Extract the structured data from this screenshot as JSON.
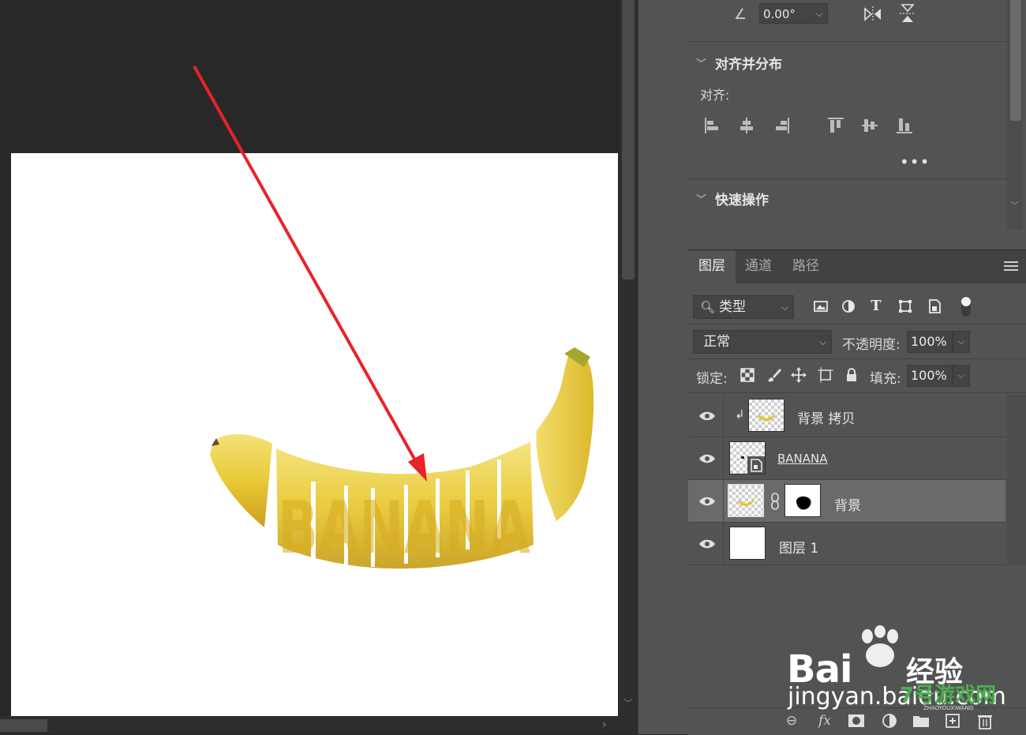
{
  "properties": {
    "angle_value": "0.00°",
    "align_section_title": "对齐并分布",
    "align_label": "对齐:",
    "more_dots": "•••",
    "quick_actions_title": "快速操作"
  },
  "layers_panel": {
    "tabs": [
      {
        "label": "图层",
        "active": true
      },
      {
        "label": "通道",
        "active": false
      },
      {
        "label": "路径",
        "active": false
      }
    ],
    "filter_kind": "类型",
    "blend_mode": "正常",
    "opacity_label": "不透明度:",
    "opacity_value": "100%",
    "lock_label": "锁定:",
    "fill_label": "填充:",
    "fill_value": "100%",
    "layers": [
      {
        "name": "背景 拷贝",
        "type": "clipped-pixel",
        "selected": false
      },
      {
        "name": "BANANA",
        "type": "smart-object",
        "selected": false
      },
      {
        "name": "背景",
        "type": "pixel-with-mask",
        "selected": true
      },
      {
        "name": "图层 1",
        "type": "white-fill",
        "selected": false
      }
    ]
  },
  "canvas": {
    "artwork_text": "BANANA"
  },
  "watermark": {
    "brand": "Bai",
    "brand_suffix": "经验",
    "url": "jingyan.baidu.com",
    "secondary": "7号游戏网",
    "secondary_sub": "ZHAOYOUXIWANG"
  },
  "colors": {
    "panel_bg": "#535353",
    "workspace_bg": "#282828",
    "arrow_red": "#e8232a",
    "banana_yellow": "#e8c830"
  }
}
